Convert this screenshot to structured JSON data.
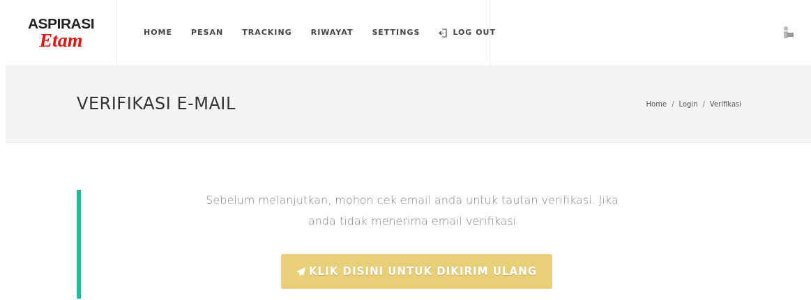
{
  "logo": {
    "line1": "ASPIRASI",
    "line2": "Etam"
  },
  "nav": [
    {
      "label": "HOME",
      "kind": "link"
    },
    {
      "label": "PESAN",
      "kind": "link"
    },
    {
      "label": "TRACKING",
      "kind": "link"
    },
    {
      "label": "RIWAYAT",
      "kind": "link"
    },
    {
      "label": "SETTINGS",
      "kind": "link"
    },
    {
      "label": "LOG OUT",
      "kind": "logout"
    }
  ],
  "page_title": "VERIFIKASI E-MAIL",
  "breadcrumb": [
    {
      "label": "Home"
    },
    {
      "separator": "/",
      "label": "Login"
    },
    {
      "separator": "/",
      "label": "Verifikasi"
    }
  ],
  "message": "Sebelum melanjutkan, mohon cek email anda untuk tautan verifikasi. Jika anda tidak menerima email verifikasi",
  "button": "KLIK DISINI UNTUK DIKIRIM ULANG"
}
